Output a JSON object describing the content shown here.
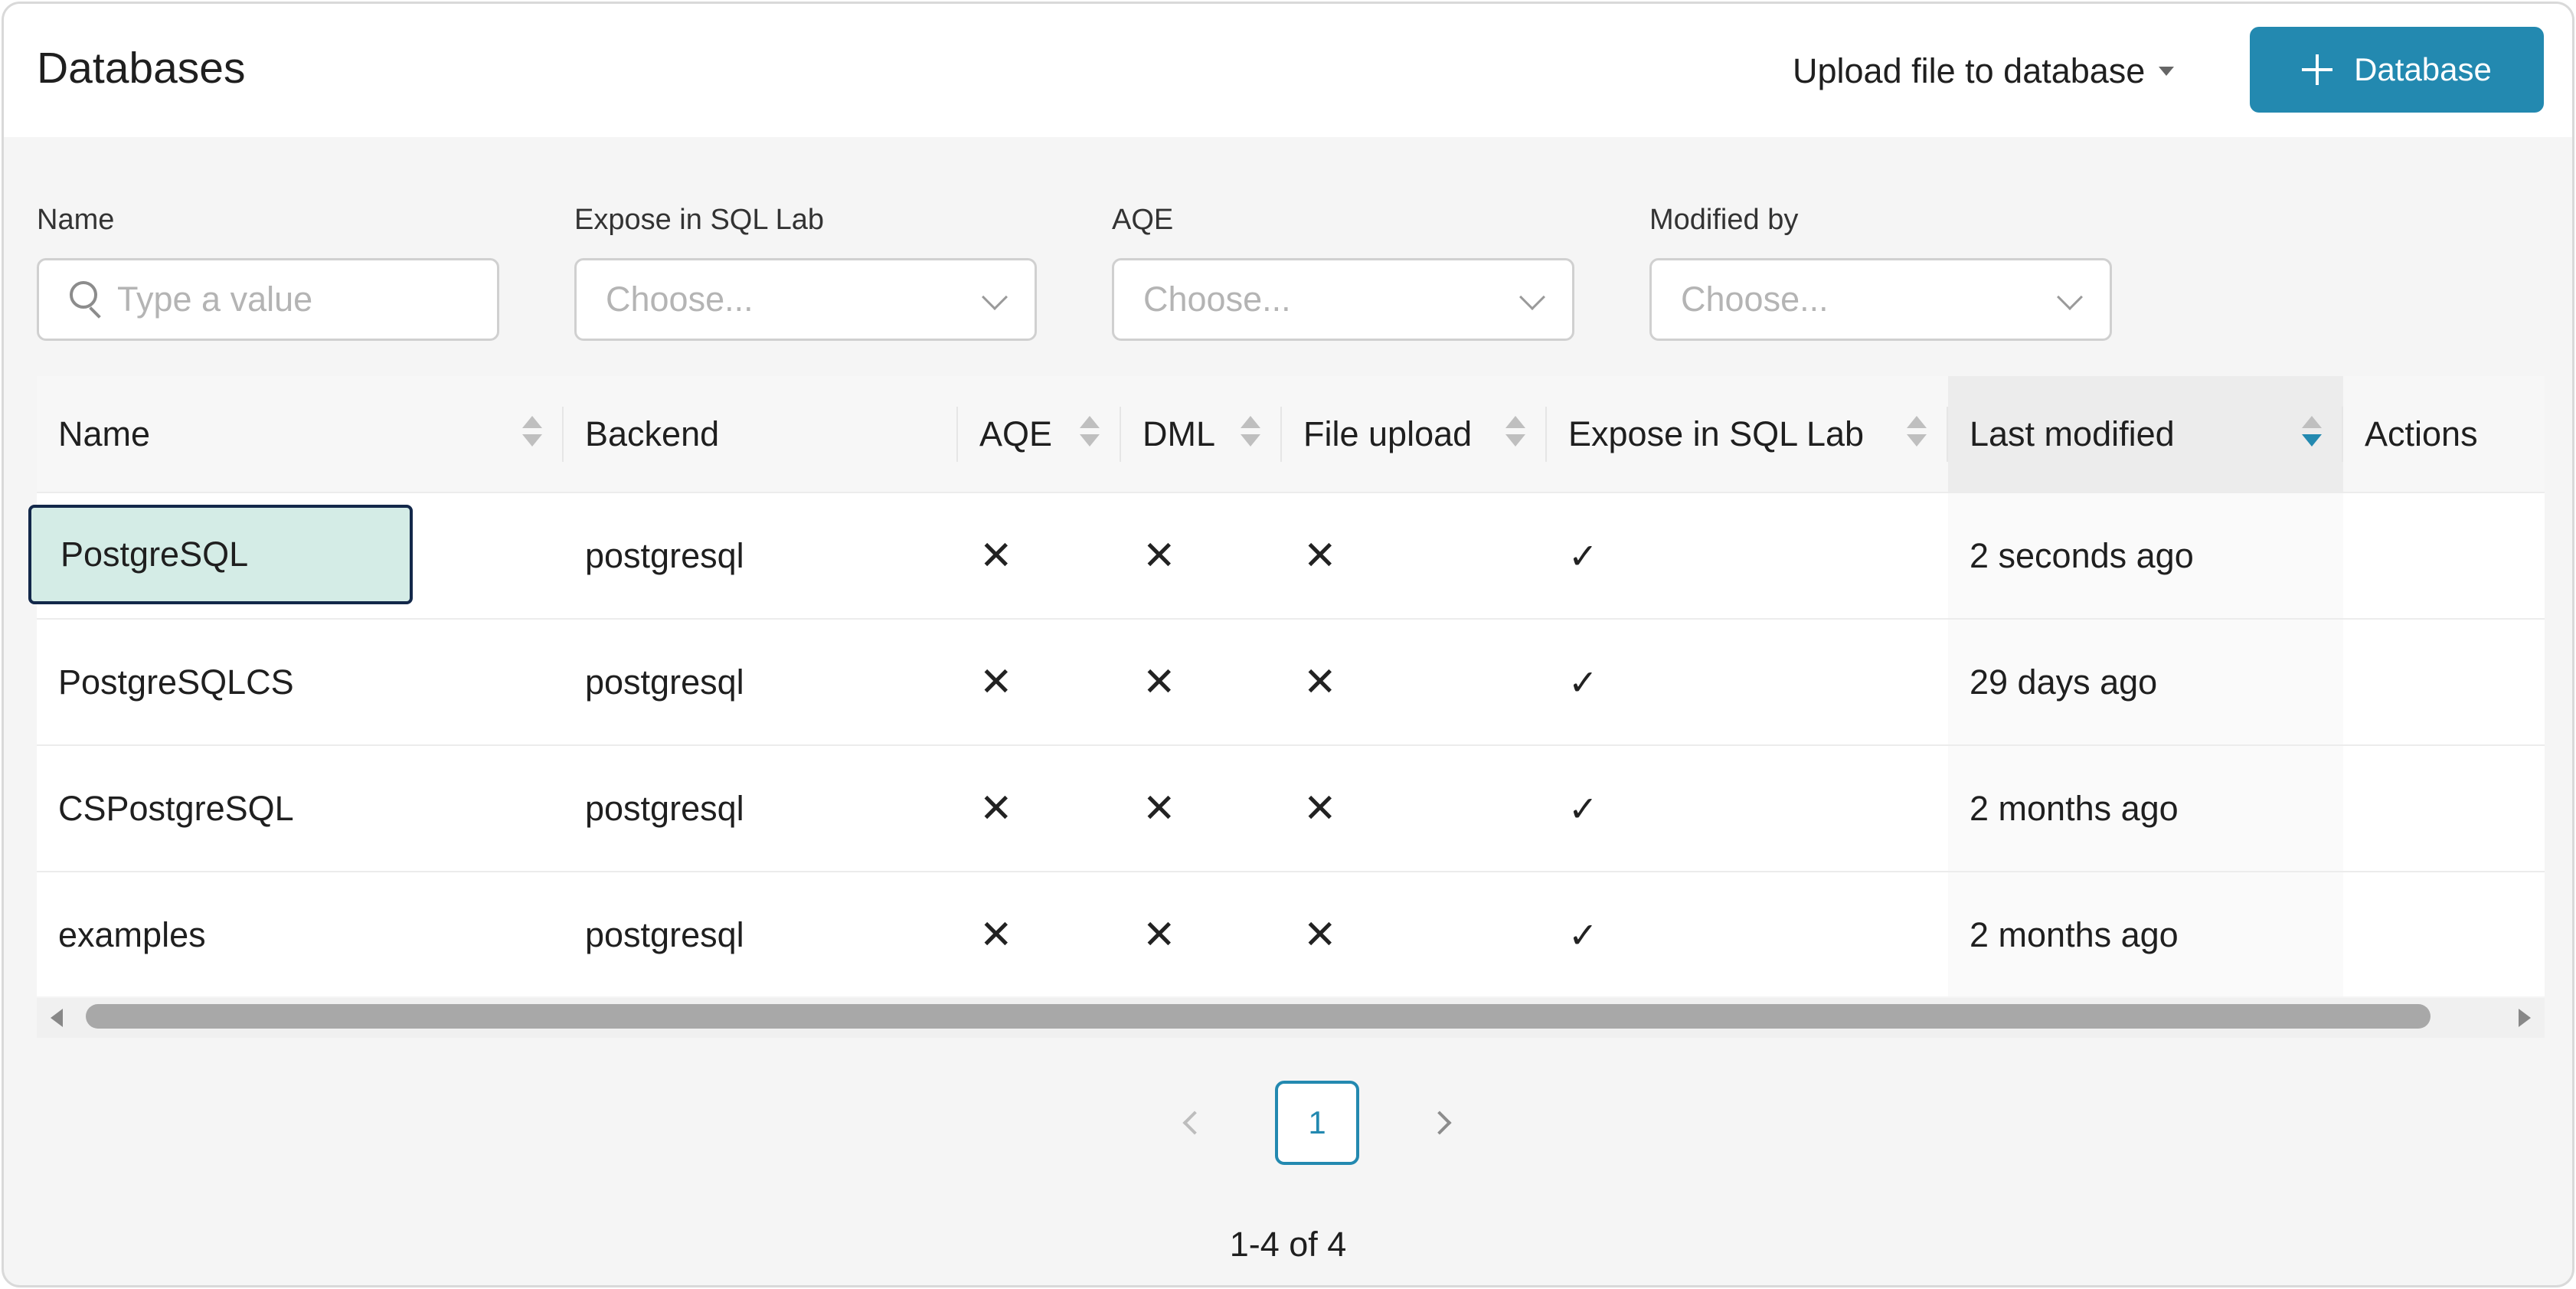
{
  "header": {
    "title": "Databases",
    "upload_label": "Upload file to database",
    "add_button_label": "Database"
  },
  "filters": [
    {
      "label": "Name",
      "placeholder": "Type a value"
    },
    {
      "label": "Expose in SQL Lab",
      "placeholder": "Choose..."
    },
    {
      "label": "AQE",
      "placeholder": "Choose..."
    },
    {
      "label": "Modified by",
      "placeholder": "Choose..."
    }
  ],
  "table": {
    "columns": [
      "Name",
      "Backend",
      "AQE",
      "DML",
      "File upload",
      "Expose in SQL Lab",
      "Last modified",
      "Actions"
    ],
    "sorted_column": "Last modified",
    "sort_direction": "descending",
    "rows": [
      {
        "name": "PostgreSQL",
        "backend": "postgresql",
        "aqe": "✕",
        "dml": "✕",
        "file_upload": "✕",
        "expose": "✓",
        "modified": "2 seconds ago"
      },
      {
        "name": "PostgreSQLCS",
        "backend": "postgresql",
        "aqe": "✕",
        "dml": "✕",
        "file_upload": "✕",
        "expose": "✓",
        "modified": "29 days ago"
      },
      {
        "name": "CSPostgreSQL",
        "backend": "postgresql",
        "aqe": "✕",
        "dml": "✕",
        "file_upload": "✕",
        "expose": "✓",
        "modified": "2 months ago"
      },
      {
        "name": "examples",
        "backend": "postgresql",
        "aqe": "✕",
        "dml": "✕",
        "file_upload": "✕",
        "expose": "✓",
        "modified": "2 months ago"
      }
    ]
  },
  "pagination": {
    "current_page": "1",
    "range_text": "1-4 of 4"
  },
  "colors": {
    "accent": "#2389b0",
    "focus_fill": "#d4ece6",
    "focus_border": "#13284a"
  },
  "icons": {
    "add": "plus-icon",
    "search": "search-icon",
    "dropdown": "chevron-down-icon",
    "sort": "sort-icon",
    "false_value": "x-icon",
    "true_value": "check-icon"
  }
}
